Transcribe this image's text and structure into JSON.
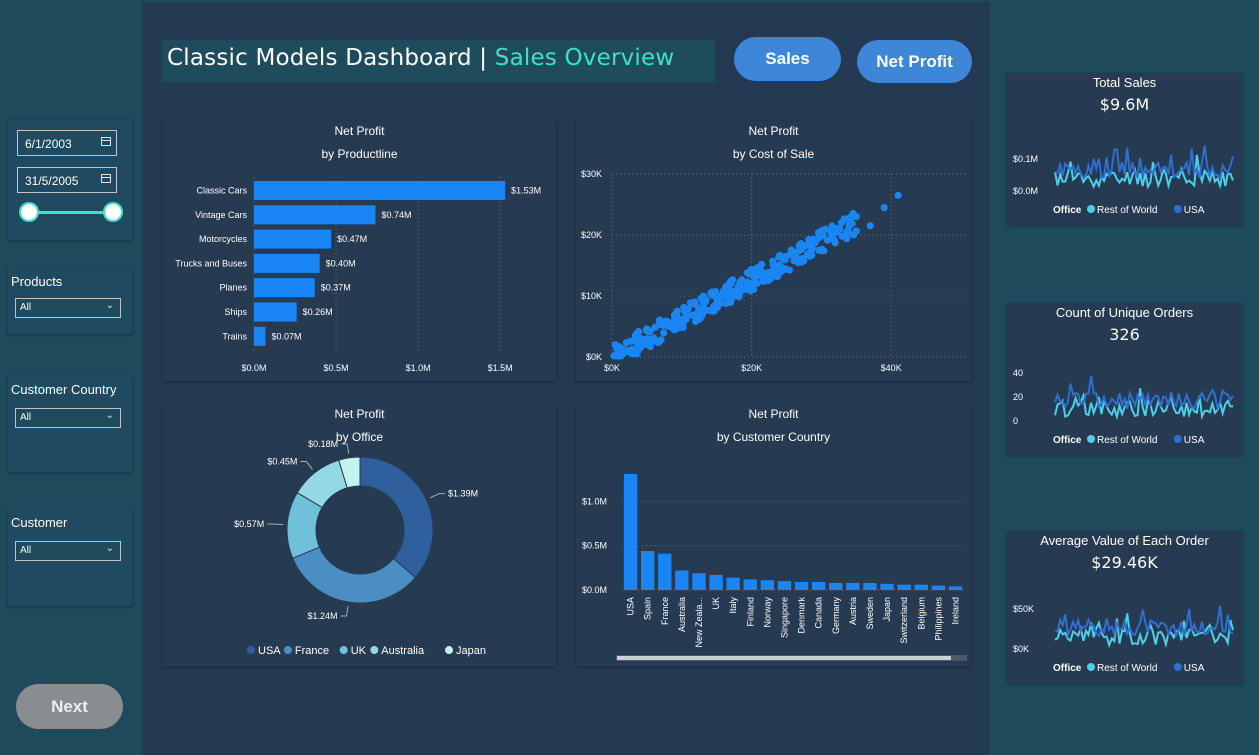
{
  "header": {
    "title_main": "Classic Models Dashboard | ",
    "title_accent": "Sales Overview",
    "sales_button": "Sales",
    "net_profit_button": "Net Profit"
  },
  "filters": {
    "date_start": "6/1/2003",
    "date_end": "31/5/2005",
    "products": {
      "label": "Products",
      "value": "All"
    },
    "customer_country": {
      "label": "Customer Country",
      "value": "All"
    },
    "customer": {
      "label": "Customer",
      "value": "All"
    },
    "next_button": "Next"
  },
  "charts": {
    "productline": {
      "title": "Net Profit",
      "subtitle": "by Productline",
      "chart_data": {
        "type": "bar",
        "orientation": "horizontal",
        "categories": [
          "Classic Cars",
          "Vintage Cars",
          "Motorcycles",
          "Trucks and Buses",
          "Planes",
          "Ships",
          "Trains"
        ],
        "values": [
          1.53,
          0.74,
          0.47,
          0.4,
          0.37,
          0.26,
          0.07
        ],
        "data_labels": [
          "$1.53M",
          "$0.74M",
          "$0.47M",
          "$0.40M",
          "$0.37M",
          "$0.26M",
          "$0.07M"
        ],
        "x_ticks": [
          "$0.0M",
          "$0.5M",
          "$1.0M",
          "$1.5M"
        ],
        "xlim": [
          0,
          1.7
        ],
        "color": "#1a86f5"
      }
    },
    "cost_of_sale": {
      "title": "Net Profit",
      "subtitle": "by Cost of Sale",
      "chart_data": {
        "type": "scatter",
        "x_ticks": [
          "$0K",
          "$20K",
          "$40K"
        ],
        "y_ticks": [
          "$0K",
          "$10K",
          "$20K",
          "$30K"
        ],
        "xlim": [
          0,
          50
        ],
        "ylim": [
          0,
          30
        ],
        "color": "#1a86f5",
        "trend": {
          "x_from": 0,
          "x_to": 41,
          "slope": 0.63
        }
      }
    },
    "office": {
      "title": "Net Profit",
      "subtitle": "by Office",
      "chart_data": {
        "type": "pie",
        "variant": "donut",
        "categories": [
          "USA",
          "France",
          "UK",
          "Australia",
          "Japan"
        ],
        "values": [
          1.39,
          1.24,
          0.57,
          0.45,
          0.18
        ],
        "data_labels": [
          "$1.39M",
          "$1.24M",
          "$0.57M",
          "$0.45M",
          "$0.18M"
        ],
        "colors": [
          "#2f5f9c",
          "#4a8ec4",
          "#6ec1d8",
          "#94d8e4",
          "#c4f2ee"
        ],
        "legend_position": "bottom"
      }
    },
    "customer_country": {
      "title": "Net Profit",
      "subtitle": "by Customer Country",
      "chart_data": {
        "type": "bar",
        "categories": [
          "USA",
          "Spain",
          "France",
          "Australia",
          "New Zeala...",
          "UK",
          "Italy",
          "Finland",
          "Norway",
          "Singapore",
          "Denmark",
          "Canada",
          "Germany",
          "Austria",
          "Sweden",
          "Japan",
          "Switzerland",
          "Belgium",
          "Philippines",
          "Ireland"
        ],
        "values": [
          1.31,
          0.44,
          0.41,
          0.22,
          0.19,
          0.17,
          0.14,
          0.12,
          0.11,
          0.1,
          0.09,
          0.09,
          0.08,
          0.08,
          0.08,
          0.07,
          0.06,
          0.06,
          0.05,
          0.04
        ],
        "y_ticks": [
          "$0.0M",
          "$0.5M",
          "$1.0M"
        ],
        "ylim": [
          0,
          1.4
        ],
        "color": "#1a86f5"
      }
    }
  },
  "kpis": {
    "total_sales": {
      "title": "Total Sales",
      "value": "$9.6M",
      "y_ticks": [
        "$0.1M",
        "$0.0M"
      ],
      "ylim": [
        0,
        0.15
      ]
    },
    "unique_orders": {
      "title": "Count of Unique Orders",
      "value": "326",
      "y_ticks": [
        "40",
        "20",
        "0"
      ],
      "ylim": [
        0,
        40
      ]
    },
    "avg_order": {
      "title": "Average Value of Each Order",
      "value": "$29.46K",
      "y_ticks": [
        "$50K",
        "$0K"
      ],
      "ylim": [
        0,
        60
      ]
    },
    "legend": {
      "title": "Office",
      "items": [
        "Rest of World",
        "USA"
      ],
      "colors": [
        "#4cd0e8",
        "#2e6fcf"
      ]
    }
  }
}
